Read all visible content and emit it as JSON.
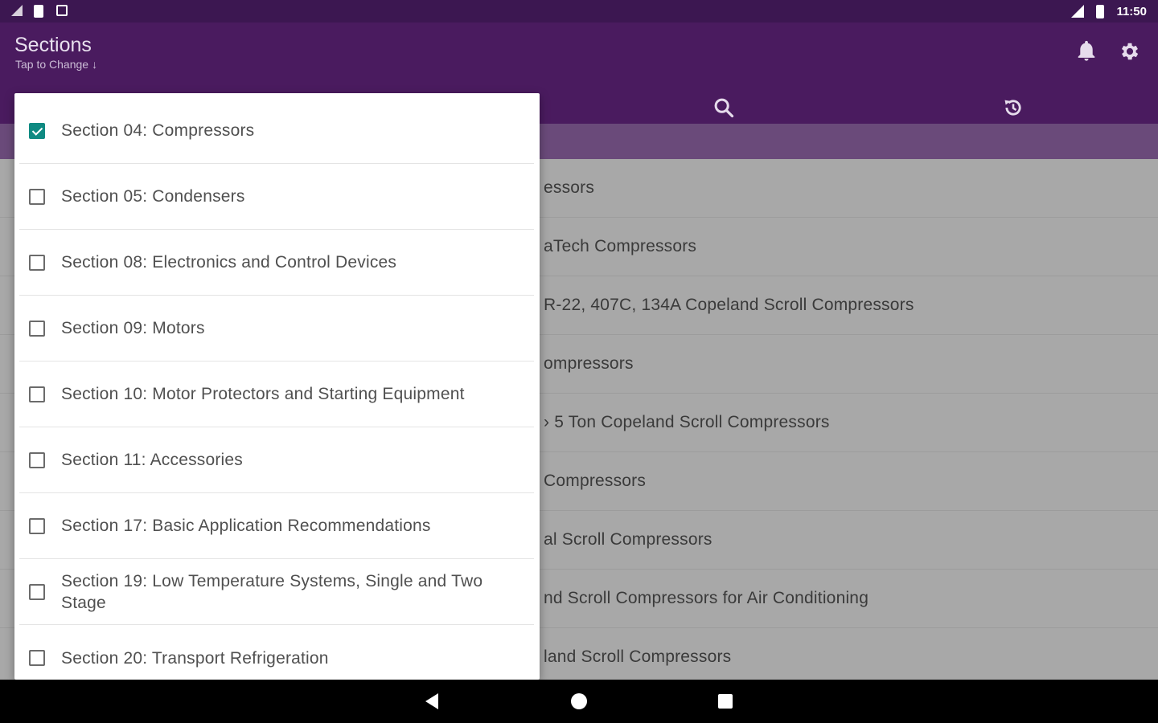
{
  "status_bar": {
    "time": "11:50"
  },
  "app_bar": {
    "title": "Sections",
    "subtitle": "Tap to Change",
    "subtitle_arrow": "↓"
  },
  "tabs": [
    {
      "icon": "search-icon"
    },
    {
      "icon": "history-icon"
    }
  ],
  "colors": {
    "app_bar": "#4a1b5f",
    "status_bar": "#3c1751",
    "checkbox_checked": "#0f8a82"
  },
  "background_list": [
    "essors",
    "aTech Compressors",
    " R-22, 407C, 134A Copeland Scroll Compressors",
    "ompressors",
    "› 5 Ton Copeland Scroll Compressors",
    " Compressors",
    "al Scroll Compressors",
    "nd Scroll Compressors for Air Conditioning",
    "land Scroll Compressors"
  ],
  "sections_menu": [
    {
      "label": "Section 04: Compressors",
      "checked": true
    },
    {
      "label": "Section 05: Condensers",
      "checked": false
    },
    {
      "label": "Section 08: Electronics and Control Devices",
      "checked": false
    },
    {
      "label": "Section 09: Motors",
      "checked": false
    },
    {
      "label": "Section 10: Motor Protectors and Starting Equipment",
      "checked": false
    },
    {
      "label": "Section 11: Accessories",
      "checked": false
    },
    {
      "label": "Section 17: Basic Application Recommendations",
      "checked": false
    },
    {
      "label": "Section 19: Low Temperature Systems, Single and Two Stage",
      "checked": false
    },
    {
      "label": "Section 20: Transport Refrigeration",
      "checked": false
    }
  ]
}
